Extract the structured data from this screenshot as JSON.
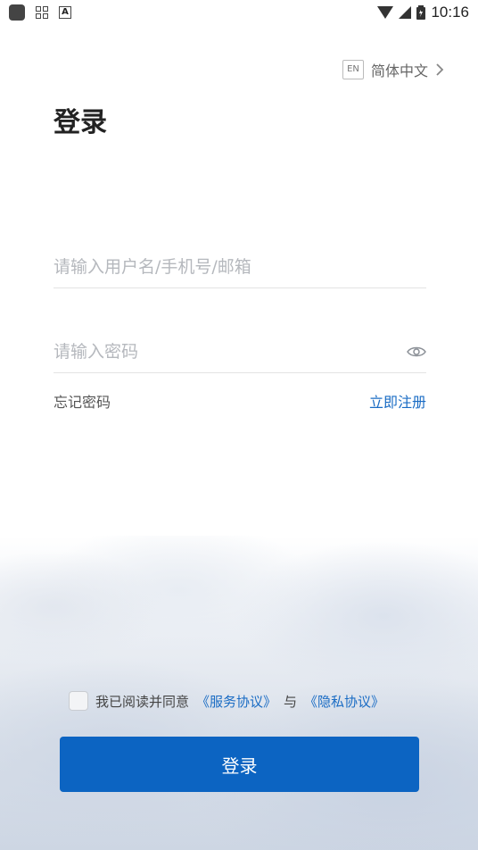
{
  "status_bar": {
    "time": "10:16"
  },
  "language": {
    "badge": "EN",
    "label": "简体中文"
  },
  "page_title": "登录",
  "username": {
    "placeholder": "请输入用户名/手机号/邮箱",
    "value": ""
  },
  "password": {
    "placeholder": "请输入密码",
    "value": ""
  },
  "links": {
    "forgot_password": "忘记密码",
    "register": "立即注册"
  },
  "agreement": {
    "prefix": "我已阅读并同意",
    "service": "《服务协议》",
    "and": "与",
    "privacy": "《隐私协议》",
    "checked": false
  },
  "login_button": "登录",
  "colors": {
    "accent": "#0c64c2",
    "link": "#1a6cc4"
  }
}
